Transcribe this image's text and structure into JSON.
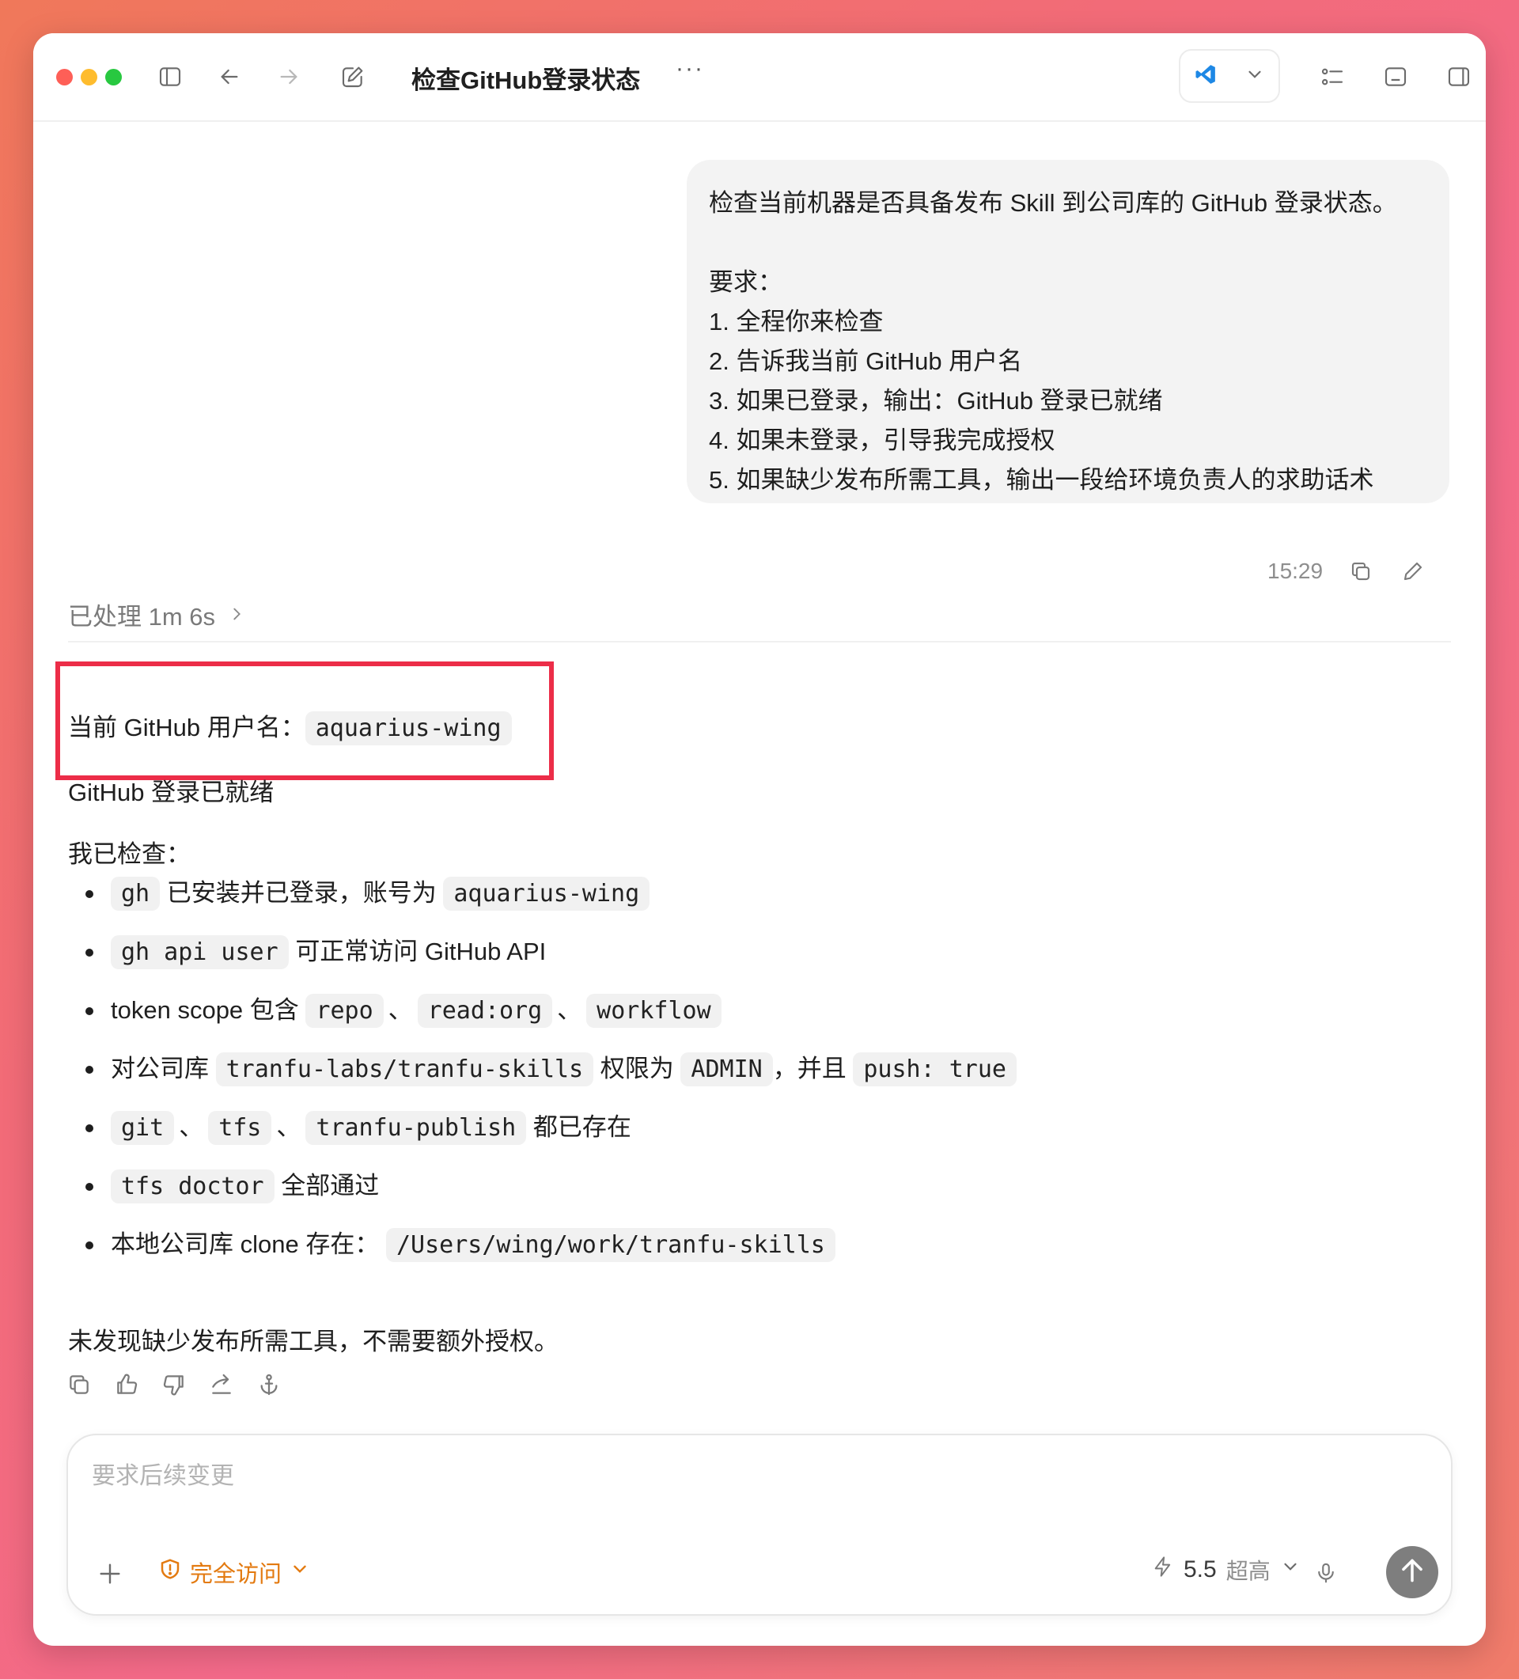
{
  "window": {
    "title": "检查GitHub登录状态",
    "more": "···"
  },
  "user_message": {
    "lines": [
      "检查当前机器是否具备发布 Skill 到公司库的 GitHub 登录状态。",
      "",
      "要求：",
      "1. 全程你来检查",
      "2. 告诉我当前 GitHub 用户名",
      "3. 如果已登录，输出：GitHub 登录已就绪",
      "4. 如果未登录，引导我完成授权",
      "5. 如果缺少发布所需工具，输出一段给环境负责人的求助话术"
    ],
    "time": "15:29"
  },
  "processed": {
    "label": "已处理 1m 6s"
  },
  "answer": {
    "username_label": "当前 GitHub 用户名：",
    "username": "aquarius-wing",
    "status": "GitHub 登录已就绪",
    "checked_label": "我已检查：",
    "bullets": {
      "b1": {
        "c1": "gh",
        "t1": "已安装并已登录，账号为",
        "c2": "aquarius-wing"
      },
      "b2": {
        "c1": "gh api user",
        "t1": "可正常访问 GitHub API"
      },
      "b3": {
        "t1": "token scope 包含",
        "c1": "repo",
        "s1": "、",
        "c2": "read:org",
        "s2": "、",
        "c3": "workflow"
      },
      "b4": {
        "t1": "对公司库",
        "c1": "tranfu-labs/tranfu-skills",
        "t2": "权限为",
        "c2": "ADMIN",
        "t3": "，并且",
        "c3": "push: true"
      },
      "b5": {
        "c1": "git",
        "s1": "、",
        "c2": "tfs",
        "s2": "、",
        "c3": "tranfu-publish",
        "t1": "都已存在"
      },
      "b6": {
        "c1": "tfs doctor",
        "t1": "全部通过"
      },
      "b7": {
        "t1": "本地公司库 clone 存在：",
        "c1": "/Users/wing/work/tranfu-skills"
      }
    },
    "conclusion": "未发现缺少发布所需工具，不需要额外授权。"
  },
  "composer": {
    "placeholder": "要求后续变更",
    "access_label": "完全访问",
    "model_version": "5.5",
    "model_tier": "超高"
  },
  "colors": {
    "highlight_border": "#ec2d48",
    "access_orange": "#e37a10",
    "send_button": "#7e7e7e"
  },
  "icons": [
    "sidebar-toggle-icon",
    "back-arrow-icon",
    "forward-arrow-icon",
    "compose-icon",
    "vscode-icon",
    "chevron-down-icon",
    "checklist-icon",
    "bottom-panel-icon",
    "right-panel-icon",
    "copy-icon",
    "edit-pencil-icon",
    "chevron-right-icon",
    "thumbs-up-icon",
    "thumbs-down-icon",
    "share-icon",
    "anchor-icon",
    "plus-icon",
    "warning-circle-icon",
    "lightning-icon",
    "mic-icon",
    "arrow-up-icon"
  ]
}
